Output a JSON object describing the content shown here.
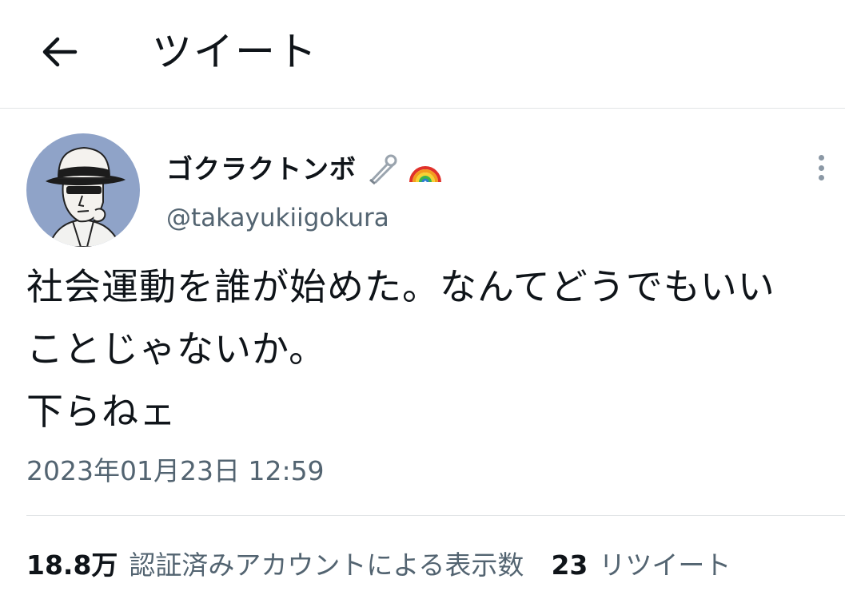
{
  "header": {
    "title": "ツイート",
    "back_icon": "arrow-left-icon"
  },
  "tweet": {
    "author": {
      "display_name": "ゴクラクトンボ",
      "badges": [
        "safety-pin-icon",
        "rainbow-icon"
      ],
      "handle": "@takayukiigokura",
      "avatar_icon": "hat-man-illustration",
      "avatar_bg": "#8fa3c8"
    },
    "text": "社会運動を誰が始めた。なんてどうでもいい\nことじゃないか。\n下らねェ",
    "timestamp": "2023年01月23日 12:59",
    "more_icon": "more-vertical-icon"
  },
  "stats": {
    "views_count": "18.8万",
    "views_label": "認証済みアカウントによる表示数",
    "retweets_count": "23",
    "retweets_label": "リツイート"
  },
  "colors": {
    "text_primary": "#0f1419",
    "text_secondary": "#536471",
    "divider": "#e1e4e6"
  }
}
